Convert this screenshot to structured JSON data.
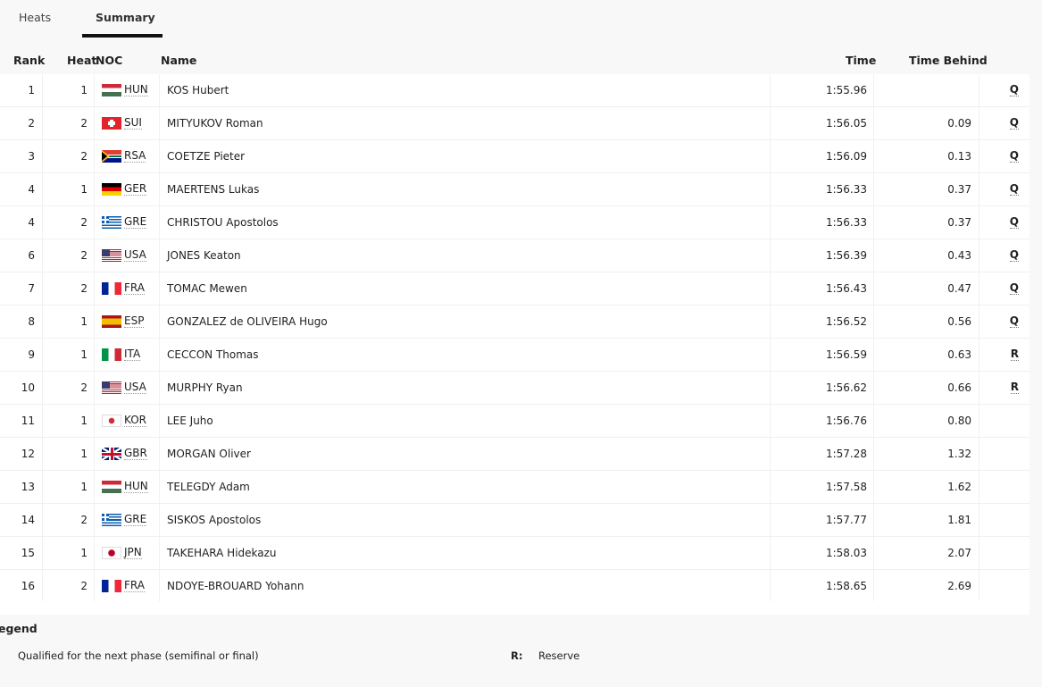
{
  "tabs": [
    {
      "label": "Heats",
      "active": false
    },
    {
      "label": "Summary",
      "active": true
    }
  ],
  "columns": {
    "rank": "Rank",
    "heat": "Heat",
    "noc": "NOC",
    "name": "Name",
    "time": "Time",
    "time_behind": "Time Behind"
  },
  "rows": [
    {
      "rank": "1",
      "heat": "1",
      "noc": "HUN",
      "name": "KOS Hubert",
      "time": "1:55.96",
      "behind": "",
      "mark": "Q"
    },
    {
      "rank": "2",
      "heat": "2",
      "noc": "SUI",
      "name": "MITYUKOV Roman",
      "time": "1:56.05",
      "behind": "0.09",
      "mark": "Q"
    },
    {
      "rank": "3",
      "heat": "2",
      "noc": "RSA",
      "name": "COETZE Pieter",
      "time": "1:56.09",
      "behind": "0.13",
      "mark": "Q"
    },
    {
      "rank": "4",
      "heat": "1",
      "noc": "GER",
      "name": "MAERTENS Lukas",
      "time": "1:56.33",
      "behind": "0.37",
      "mark": "Q"
    },
    {
      "rank": "4",
      "heat": "2",
      "noc": "GRE",
      "name": "CHRISTOU Apostolos",
      "time": "1:56.33",
      "behind": "0.37",
      "mark": "Q"
    },
    {
      "rank": "6",
      "heat": "2",
      "noc": "USA",
      "name": "JONES Keaton",
      "time": "1:56.39",
      "behind": "0.43",
      "mark": "Q"
    },
    {
      "rank": "7",
      "heat": "2",
      "noc": "FRA",
      "name": "TOMAC Mewen",
      "time": "1:56.43",
      "behind": "0.47",
      "mark": "Q"
    },
    {
      "rank": "8",
      "heat": "1",
      "noc": "ESP",
      "name": "GONZALEZ de OLIVEIRA Hugo",
      "time": "1:56.52",
      "behind": "0.56",
      "mark": "Q"
    },
    {
      "rank": "9",
      "heat": "1",
      "noc": "ITA",
      "name": "CECCON Thomas",
      "time": "1:56.59",
      "behind": "0.63",
      "mark": "R"
    },
    {
      "rank": "10",
      "heat": "2",
      "noc": "USA",
      "name": "MURPHY Ryan",
      "time": "1:56.62",
      "behind": "0.66",
      "mark": "R"
    },
    {
      "rank": "11",
      "heat": "1",
      "noc": "KOR",
      "name": "LEE Juho",
      "time": "1:56.76",
      "behind": "0.80",
      "mark": ""
    },
    {
      "rank": "12",
      "heat": "1",
      "noc": "GBR",
      "name": "MORGAN Oliver",
      "time": "1:57.28",
      "behind": "1.32",
      "mark": ""
    },
    {
      "rank": "13",
      "heat": "1",
      "noc": "HUN",
      "name": "TELEGDY Adam",
      "time": "1:57.58",
      "behind": "1.62",
      "mark": ""
    },
    {
      "rank": "14",
      "heat": "2",
      "noc": "GRE",
      "name": "SISKOS Apostolos",
      "time": "1:57.77",
      "behind": "1.81",
      "mark": ""
    },
    {
      "rank": "15",
      "heat": "1",
      "noc": "JPN",
      "name": "TAKEHARA Hidekazu",
      "time": "1:58.03",
      "behind": "2.07",
      "mark": ""
    },
    {
      "rank": "16",
      "heat": "2",
      "noc": "FRA",
      "name": "NDOYE-BROUARD Yohann",
      "time": "1:58.65",
      "behind": "2.69",
      "mark": ""
    }
  ],
  "legend": {
    "title": "egend",
    "q_text": "Qualified for the next phase (semifinal or final)",
    "r_key": "R:",
    "r_text": "Reserve"
  }
}
